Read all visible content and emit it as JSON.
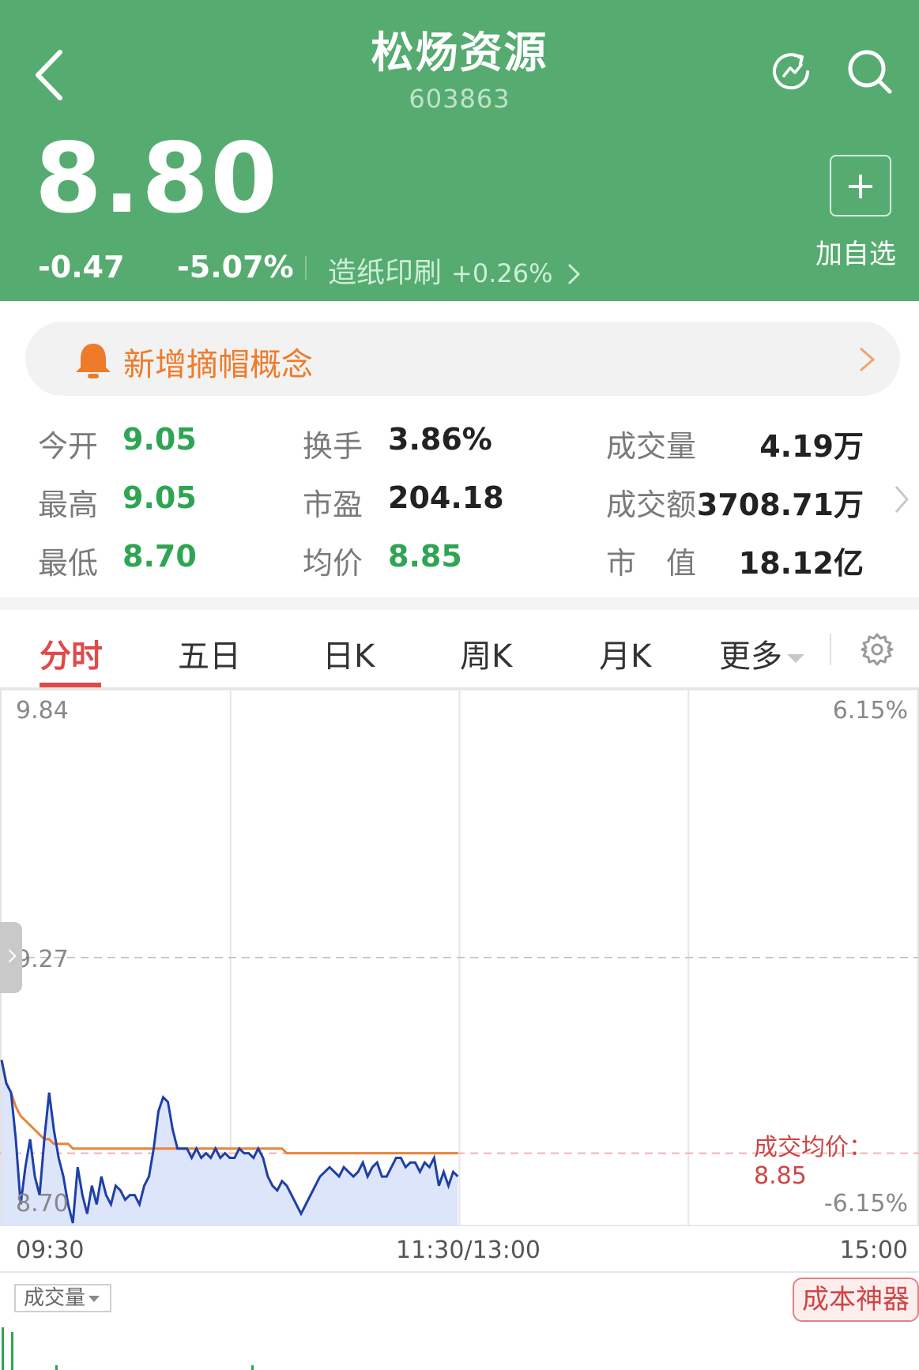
{
  "header": {
    "title": "松炀资源",
    "code": "603863",
    "price": "8.80",
    "change": "-0.47",
    "change_pct": "-5.07%",
    "industry": "造纸印刷",
    "industry_pct": "+0.26%",
    "add_label": "加自选",
    "bg_color": "#56ab71"
  },
  "notice": {
    "text": "新增摘帽概念",
    "color": "#ee7b2a"
  },
  "stats": {
    "open_label": "今开",
    "open": "9.05",
    "high_label": "最高",
    "high": "9.05",
    "low_label": "最低",
    "low": "8.70",
    "turnover_label": "换手",
    "turnover": "3.86%",
    "pe_label": "市盈",
    "pe": "204.18",
    "avg_label": "均价",
    "avg": "8.85",
    "volume_label": "成交量",
    "volume": "4.19万",
    "amount_label": "成交额",
    "amount": "3708.71万",
    "mcap_label": "市　值",
    "mcap": "18.12亿"
  },
  "tabs": [
    "分时",
    "五日",
    "日K",
    "周K",
    "月K",
    "更多"
  ],
  "chart": {
    "y_top": "9.84",
    "y_mid": "9.27",
    "y_bottom": "8.70",
    "pct_top": "6.15%",
    "pct_bottom": "-6.15%",
    "avg_text": "成交均价：8.85",
    "time_start": "09:30",
    "time_mid": "11:30/13:00",
    "time_end": "15:00",
    "volume_dropdown": "成交量",
    "cost_button": "成本神器"
  },
  "chart_data": {
    "type": "line",
    "ylim": [
      8.7,
      9.84
    ],
    "pre_close": 9.27,
    "series": [
      {
        "values": [
          9.05,
          9.0,
          8.98,
          8.88,
          8.74,
          8.82,
          8.88,
          8.8,
          8.76,
          8.88,
          8.98,
          8.9,
          8.84,
          8.8,
          8.74,
          8.7,
          8.82,
          8.76,
          8.72,
          8.78,
          8.74,
          8.8,
          8.76,
          8.74,
          8.78,
          8.77,
          8.75,
          8.76,
          8.76,
          8.74,
          8.78,
          8.8,
          8.86,
          8.94,
          8.97,
          8.96,
          8.9,
          8.86,
          8.86,
          8.86,
          8.84,
          8.86,
          8.84,
          8.85,
          8.84,
          8.86,
          8.84,
          8.85,
          8.84,
          8.84,
          8.86,
          8.85,
          8.85,
          8.84,
          8.86,
          8.84,
          8.8,
          8.78,
          8.77,
          8.79,
          8.78,
          8.76,
          8.74,
          8.72,
          8.74,
          8.76,
          8.78,
          8.8,
          8.81,
          8.82,
          8.81,
          8.8,
          8.82,
          8.81,
          8.8,
          8.81,
          8.83,
          8.8,
          8.82,
          8.83,
          8.8,
          8.8,
          8.82,
          8.84,
          8.84,
          8.82,
          8.83,
          8.83,
          8.81,
          8.83,
          8.82,
          8.84,
          8.78,
          8.81,
          8.78,
          8.81,
          8.8
        ]
      },
      {
        "values": [
          9.05,
          9.0,
          8.98,
          8.95,
          8.93,
          8.92,
          8.91,
          8.9,
          8.89,
          8.88,
          8.88,
          8.87,
          8.87,
          8.87,
          8.87,
          8.86,
          8.86,
          8.86,
          8.86,
          8.86,
          8.86,
          8.86,
          8.86,
          8.86,
          8.86,
          8.86,
          8.86,
          8.86,
          8.86,
          8.86,
          8.86,
          8.86,
          8.86,
          8.86,
          8.86,
          8.86,
          8.86,
          8.86,
          8.86,
          8.86,
          8.86,
          8.86,
          8.86,
          8.86,
          8.86,
          8.86,
          8.86,
          8.86,
          8.86,
          8.86,
          8.86,
          8.86,
          8.86,
          8.86,
          8.86,
          8.86,
          8.86,
          8.86,
          8.86,
          8.86,
          8.85,
          8.85,
          8.85,
          8.85,
          8.85,
          8.85,
          8.85,
          8.85,
          8.85,
          8.85,
          8.85,
          8.85,
          8.85,
          8.85,
          8.85,
          8.85,
          8.85,
          8.85,
          8.85,
          8.85,
          8.85,
          8.85,
          8.85,
          8.85,
          8.85,
          8.85,
          8.85,
          8.85,
          8.85,
          8.85,
          8.85,
          8.85,
          8.85,
          8.85,
          8.85,
          8.85,
          8.85
        ]
      }
    ],
    "colors": {
      "price": "#1f3fa8",
      "avg": "#e8843a",
      "area": "#dde5fa",
      "down": "#2fa553",
      "up": "#e04a4a"
    }
  }
}
